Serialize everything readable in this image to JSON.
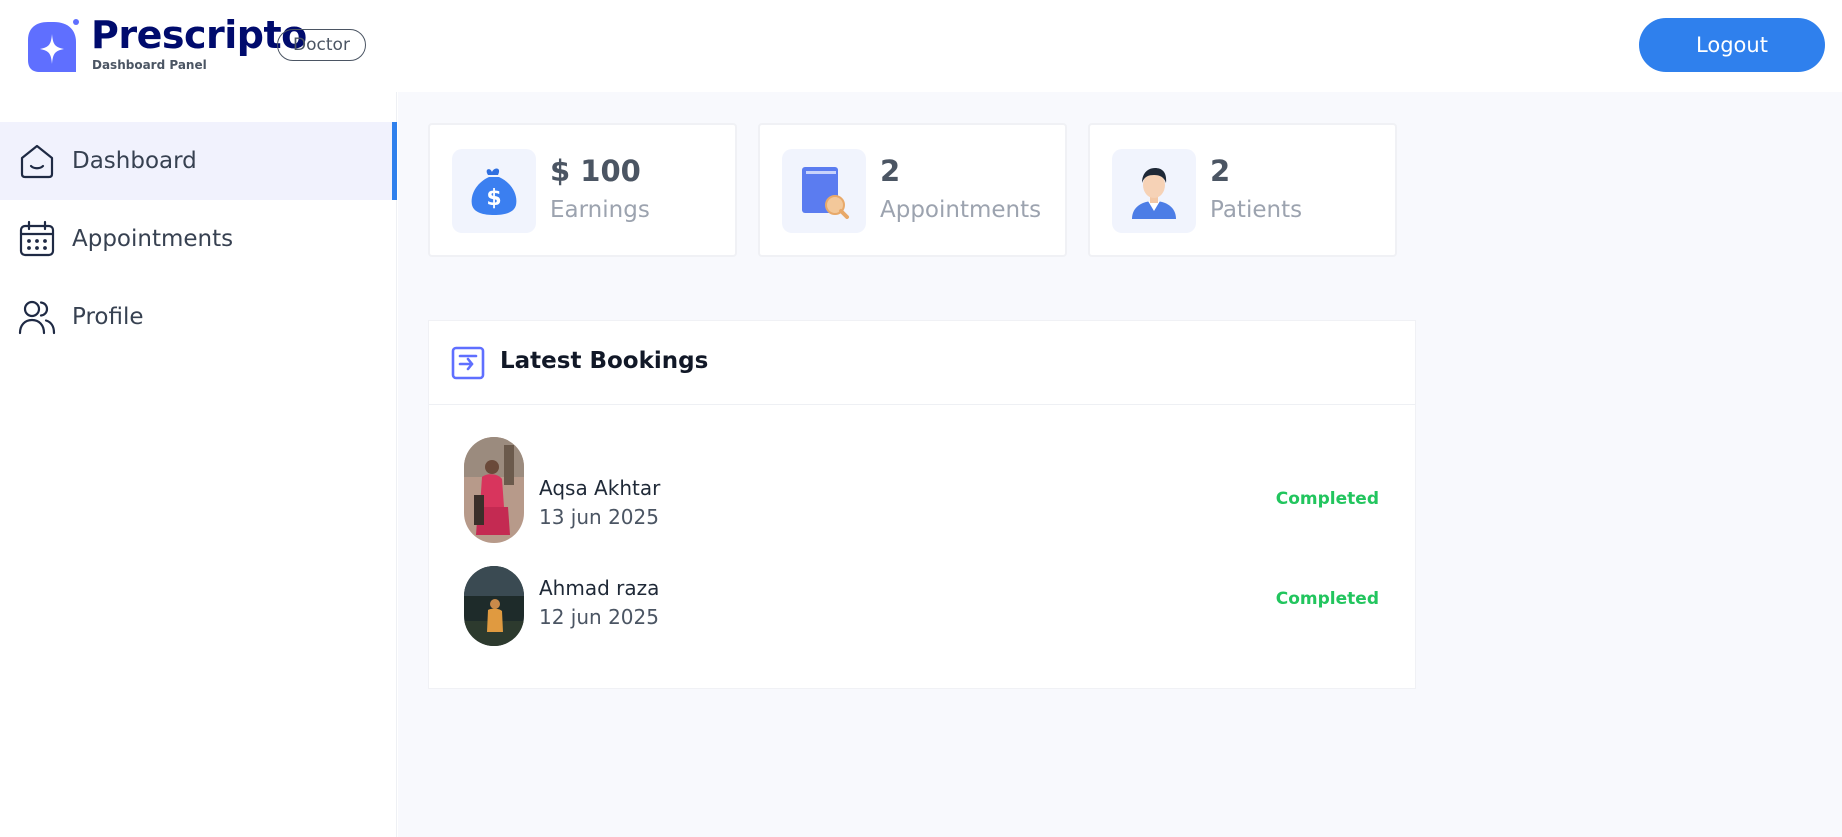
{
  "brand": {
    "name": "Prescripto",
    "subtitle": "Dashboard Panel",
    "role": "Doctor"
  },
  "header": {
    "logout_label": "Logout"
  },
  "sidebar": {
    "items": [
      {
        "label": "Dashboard",
        "icon": "home-icon",
        "active": true
      },
      {
        "label": "Appointments",
        "icon": "calendar-icon",
        "active": false
      },
      {
        "label": "Profile",
        "icon": "people-icon",
        "active": false
      }
    ]
  },
  "stats": [
    {
      "value": "$ 100",
      "label": "Earnings",
      "icon": "money-bag-icon"
    },
    {
      "value": "2",
      "label": "Appointments",
      "icon": "appointment-book-icon"
    },
    {
      "value": "2",
      "label": "Patients",
      "icon": "patient-avatar-icon"
    }
  ],
  "bookings": {
    "title": "Latest Bookings",
    "icon": "list-icon",
    "rows": [
      {
        "name": "Aqsa Akhtar",
        "date": "13 jun 2025",
        "status": "Completed"
      },
      {
        "name": "Ahmad raza",
        "date": "12 jun 2025",
        "status": "Completed"
      }
    ]
  },
  "colors": {
    "brand": "#000b6d",
    "accent": "#2f80ed",
    "completed": "#22c55e",
    "active_bg": "#f1f2fd"
  }
}
